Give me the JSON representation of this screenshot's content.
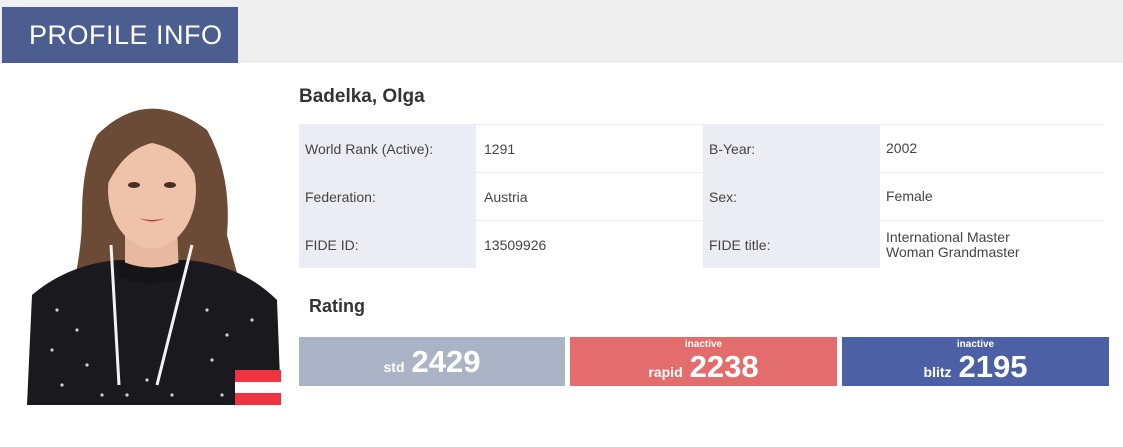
{
  "header": {
    "title": "PROFILE INFO"
  },
  "profile": {
    "name": "Badelka, Olga",
    "rows": [
      {
        "label1": "World Rank (Active):",
        "value1": "1291",
        "label2": "B-Year:",
        "value2": [
          "2002"
        ]
      },
      {
        "label1": "Federation:",
        "value1": "Austria",
        "label2": "Sex:",
        "value2": [
          "Female"
        ]
      },
      {
        "label1": "FIDE ID:",
        "value1": "13509926",
        "label2": "FIDE title:",
        "value2": [
          "International Master",
          "Woman Grandmaster"
        ]
      }
    ]
  },
  "rating": {
    "title": "Rating",
    "std": {
      "status": "",
      "type": "std",
      "value": "2429",
      "color": "#aab4c6"
    },
    "rapid": {
      "status": "inactive",
      "type": "rapid",
      "value": "2238",
      "color": "#e36c6c"
    },
    "blitz": {
      "status": "inactive",
      "type": "blitz",
      "value": "2195",
      "color": "#4c61a5"
    }
  },
  "flag": {
    "country": "Austria",
    "colors": [
      "#ef3340",
      "#ffffff",
      "#ef3340"
    ]
  },
  "colors": {
    "header": "#4c5e8f",
    "label_bg": "#ececf4"
  }
}
